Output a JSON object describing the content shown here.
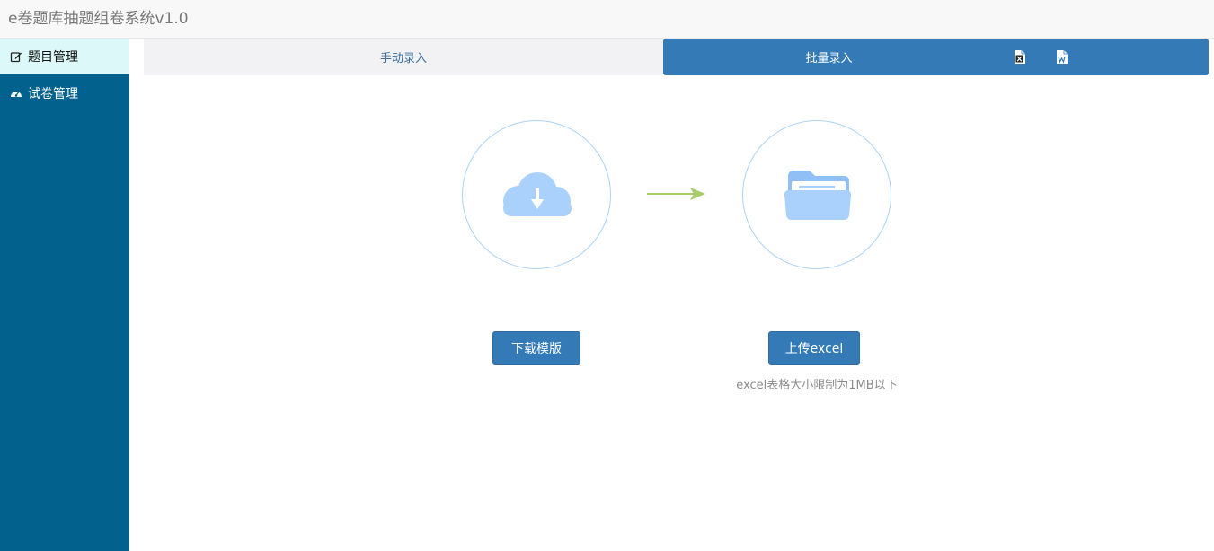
{
  "app": {
    "title": "e卷题库抽题组卷系统v1.0"
  },
  "sidebar": {
    "items": [
      {
        "label": "题目管理",
        "icon": "edit-icon",
        "active": true
      },
      {
        "label": "试卷管理",
        "icon": "dashboard-icon",
        "active": false
      }
    ]
  },
  "tabs": {
    "manual_label": "手动录入",
    "batch_label": "批量录入",
    "batch_icons": [
      "excel-file-icon",
      "word-file-icon"
    ]
  },
  "steps": {
    "download": {
      "icon": "cloud-download-icon",
      "button_label": "下载模版"
    },
    "upload": {
      "icon": "folder-icon",
      "button_label": "上传excel",
      "hint": "excel表格大小限制为1MB以下"
    }
  },
  "colors": {
    "sidebar_bg": "#03628d",
    "sidebar_active_bg": "#dcf8f8",
    "primary": "#337ab7",
    "icon_fill": "#a9d1fb",
    "arrow": "#a8cc6a"
  }
}
